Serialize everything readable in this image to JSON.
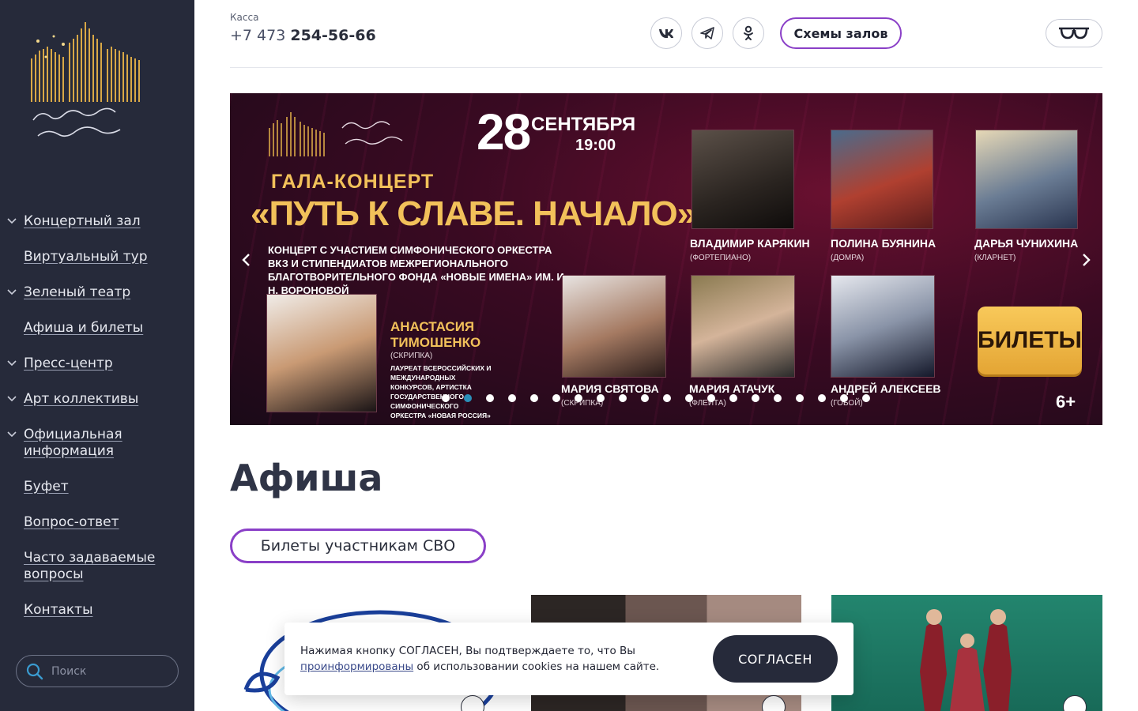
{
  "sidebar": {
    "nav": [
      {
        "label": "Концертный зал",
        "expandable": true
      },
      {
        "label": "Виртуальный тур",
        "expandable": false
      },
      {
        "label": "Зеленый театр",
        "expandable": true
      },
      {
        "label": "Афиша и билеты",
        "expandable": false
      },
      {
        "label": "Пресс-центр",
        "expandable": true
      },
      {
        "label": "Арт коллективы",
        "expandable": true
      },
      {
        "label": "Официальная информация",
        "expandable": true
      },
      {
        "label": "Буфет",
        "expandable": false
      },
      {
        "label": "Вопрос-ответ",
        "expandable": false
      },
      {
        "label": "Часто задаваемые вопросы",
        "expandable": false
      },
      {
        "label": "Контакты",
        "expandable": false
      }
    ],
    "search_placeholder": "Поиск"
  },
  "header": {
    "kassa_label": "Касса",
    "phone_prefix": "+7 473 ",
    "phone_number": "254-56-66",
    "social": [
      "vk-icon",
      "telegram-icon",
      "odnoklassniki-icon"
    ],
    "halls_button": "Схемы залов",
    "accessibility_icon": "glasses-icon"
  },
  "banner": {
    "date_day": "28",
    "date_month": "СЕНТЯБРЯ",
    "time": "19:00",
    "gala": "ГАЛА-КОНЦЕРТ",
    "title": "«ПУТЬ К СЛАВЕ. НАЧАЛО»",
    "description": "КОНЦЕРТ С УЧАСТИЕМ СИМФОНИЧЕСКОГО ОРКЕСТРА ВКЗ И СТИПЕНДИАТОВ МЕЖРЕГИОНАЛЬНОГО БЛАГОТВОРИТЕЛЬНОГО ФОНДА «НОВЫЕ ИМЕНА» ИМ. И. Н. ВОРОНОВОЙ",
    "soloist_name_1": "АНАСТАСИЯ",
    "soloist_name_2": "ТИМОШЕНКО",
    "soloist_instrument": "(СКРИПКА)",
    "soloist_desc": "ЛАУРЕАТ ВСЕРОССИЙСКИХ И МЕЖДУНАРОДНЫХ КОНКУРСОВ, АРТИСТКА ГОСУДАРСТВЕННОГО СИМФОНИЧЕСКОГО ОРКЕСТРА «НОВАЯ РОССИЯ»",
    "performers": [
      {
        "name": "ВЛАДИМИР КАРЯКИН",
        "instrument": "(ФОРТЕПИАНО)"
      },
      {
        "name": "ПОЛИНА БУЯНИНА",
        "instrument": "(ДОМРА)"
      },
      {
        "name": "ДАРЬЯ ЧУНИХИНА",
        "instrument": "(КЛАРНЕТ)"
      },
      {
        "name": "МАРИЯ СВЯТОВА",
        "instrument": "(СКРИПКА)"
      },
      {
        "name": "МАРИЯ АТАЧУК",
        "instrument": "(ФЛЕЙТА)"
      },
      {
        "name": "АНДРЕЙ АЛЕКСЕЕВ",
        "instrument": "(ГОБОЙ)"
      }
    ],
    "tickets_label": "БИЛЕТЫ",
    "age": "6+",
    "slide_count": 20,
    "active_slide": 1
  },
  "afisha": {
    "title": "Афиша",
    "svo_button": "Билеты участникам СВО"
  },
  "cookie": {
    "text_before": "Нажимая кнопку СОГЛАСЕН, Вы подтверждаете то, что Вы ",
    "link_text": "проинформированы",
    "text_after": " об использовании cookies на нашем сайте.",
    "button": "СОГЛАСЕН"
  },
  "colors": {
    "sidebar_bg": "#262a3a",
    "accent_purple": "#8a3fc7",
    "banner_gold": "#f2c15a"
  }
}
